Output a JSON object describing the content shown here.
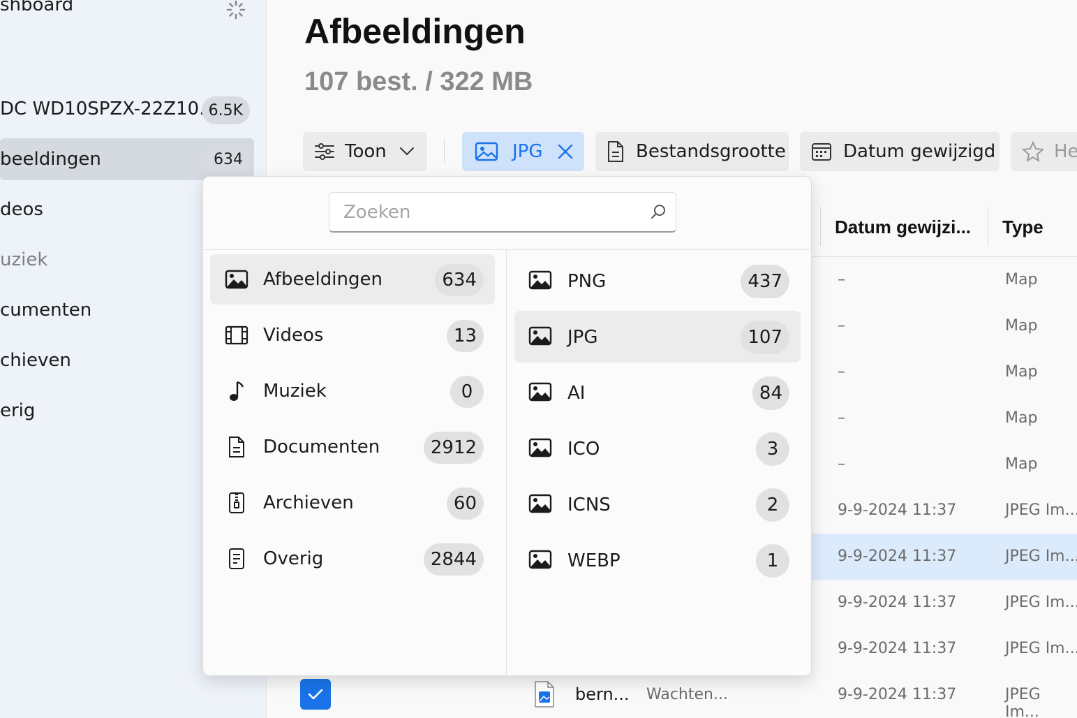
{
  "sidebar": {
    "header": "shboard",
    "items": [
      {
        "label": "DC WD10SPZX-22Z10...",
        "count": "6.5K"
      },
      {
        "label": "beeldingen",
        "count": "634"
      },
      {
        "label": "deos",
        "count": ""
      },
      {
        "label": "uziek",
        "count": ""
      },
      {
        "label": "cumenten",
        "count": ""
      },
      {
        "label": "chieven",
        "count": ""
      },
      {
        "label": "erig",
        "count": ""
      }
    ]
  },
  "main": {
    "title": "Afbeeldingen",
    "subtitle": "107 best. / 322 MB"
  },
  "toolbar": {
    "show_label": "Toon",
    "filter_jpg_label": "JPG",
    "filesize_label": "Bestandsgrootte",
    "date_modified_label": "Datum gewijzigd",
    "favorites_label": "He"
  },
  "table": {
    "headers": {
      "date": "Datum gewijzi...",
      "type": "Type"
    },
    "rows": [
      {
        "date": "–",
        "type": "Map"
      },
      {
        "date": "–",
        "type": "Map"
      },
      {
        "date": "–",
        "type": "Map"
      },
      {
        "date": "–",
        "type": "Map"
      },
      {
        "date": "–",
        "type": "Map"
      },
      {
        "date": "9-9-2024 11:37",
        "type": "JPEG Im..."
      },
      {
        "date": "9-9-2024 11:37",
        "type": "JPEG Im..."
      },
      {
        "date": "9-9-2024 11:37",
        "type": "JPEG Im..."
      },
      {
        "date": "9-9-2024 11:37",
        "type": "JPEG Im..."
      }
    ],
    "last_row": {
      "name": "bern...",
      "status": "Wachten...",
      "date": "9-9-2024 11:37",
      "type": "JPEG Im..."
    }
  },
  "popup": {
    "search_placeholder": "Zoeken",
    "categories": [
      {
        "label": "Afbeeldingen",
        "count": "634",
        "icon": "image-icon"
      },
      {
        "label": "Videos",
        "count": "13",
        "icon": "film-icon"
      },
      {
        "label": "Muziek",
        "count": "0",
        "icon": "music-note-icon"
      },
      {
        "label": "Documenten",
        "count": "2912",
        "icon": "document-icon"
      },
      {
        "label": "Archieven",
        "count": "60",
        "icon": "archive-zip-icon"
      },
      {
        "label": "Overig",
        "count": "2844",
        "icon": "other-file-icon"
      }
    ],
    "formats": [
      {
        "label": "PNG",
        "count": "437"
      },
      {
        "label": "JPG",
        "count": "107"
      },
      {
        "label": "AI",
        "count": "84"
      },
      {
        "label": "ICO",
        "count": "3"
      },
      {
        "label": "ICNS",
        "count": "2"
      },
      {
        "label": "WEBP",
        "count": "1"
      }
    ]
  },
  "colors": {
    "accent": "#1a73e8",
    "selected_chip_bg": "#cfe2fb",
    "selected_row_bg": "#dcebfc"
  }
}
